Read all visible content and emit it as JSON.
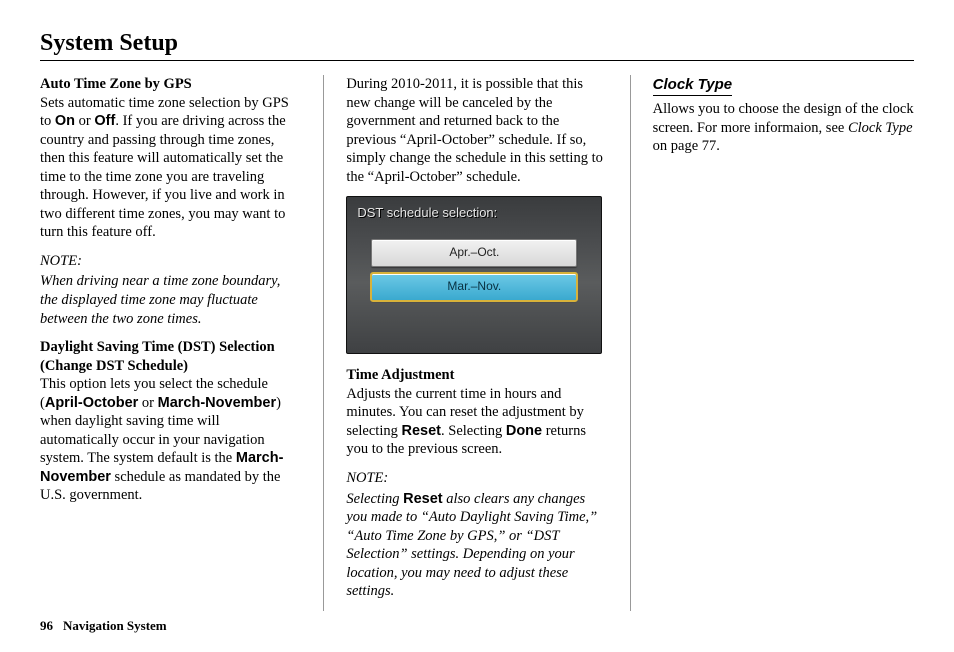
{
  "page": {
    "title": "System Setup",
    "number": "96",
    "footer_label": "Navigation System"
  },
  "col1": {
    "autoTZ": {
      "heading": "Auto Time Zone by GPS",
      "body_a": "Sets automatic time zone selection by GPS to ",
      "on": "On",
      "body_b": " or ",
      "off": "Off",
      "body_c": ". If you are driving across the country and passing through time zones, then this feature will automatically set the time to the time zone you are traveling through. However, if you live and work in two different time zones, you may want to turn this feature off."
    },
    "note1": {
      "label": "NOTE:",
      "body": "When driving near a time zone boundary, the displayed time zone may fluctuate between the two zone times."
    },
    "dst": {
      "heading": "Daylight Saving Time (DST) Selection (Change DST Schedule)",
      "body_a": "This option lets you select the schedule (",
      "opt1": "April-October",
      "body_b": " or ",
      "opt2": "March-November",
      "body_c": ") when daylight saving time will automatically occur in your navigation system. The system default is the ",
      "default": "March-November",
      "body_d": " schedule as mandated by the U.S. government."
    }
  },
  "col2": {
    "intro": "During 2010-2011, it is possible that this new change will be canceled by the government and returned back to the previous “April-October” schedule. If so, simply change the schedule in this setting to the “April-October” schedule.",
    "dstScreen": {
      "title": "DST schedule selection:",
      "option1": "Apr.–Oct.",
      "option2": "Mar.–Nov."
    },
    "timeAdj": {
      "heading": "Time Adjustment",
      "body_a": "Adjusts the current time in hours and minutes. You can reset the adjustment by selecting ",
      "reset": "Reset",
      "body_b": ". Selecting ",
      "done": "Done",
      "body_c": " returns you to the previous screen."
    },
    "note2": {
      "label": "NOTE:",
      "body_a": "Selecting ",
      "reset": "Reset",
      "body_b": " also clears any changes you made to “Auto Daylight Saving Time,” “Auto Time Zone by GPS,” or “DST Selection” settings. Depending on your location, you may need to adjust these settings."
    }
  },
  "col3": {
    "clockType": {
      "heading": "Clock Type",
      "body_a": "Allows you to choose the design of the clock screen. For more informaion, see ",
      "ref": "Clock Type",
      "body_b": " on page 77."
    }
  }
}
